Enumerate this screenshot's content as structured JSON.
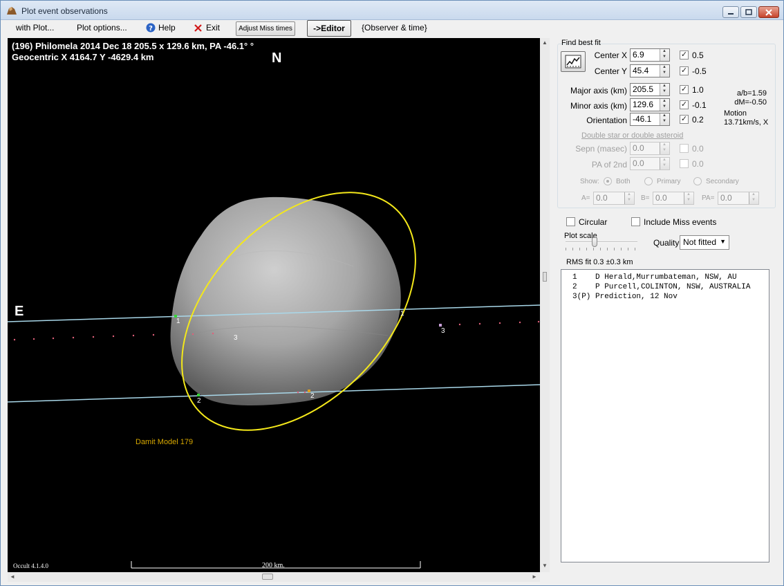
{
  "window": {
    "title": "Plot event observations"
  },
  "menu": {
    "with_plot": "with Plot...",
    "plot_options": "Plot options...",
    "help": "Help",
    "exit": "Exit",
    "adjust_miss": "Adjust Miss times",
    "editor": "->Editor",
    "observer_time": "{Observer & time}"
  },
  "plot": {
    "header_line1": "(196) Philomela  2014 Dec 18   205.5 x 129.6 km,  PA -46.1° °",
    "header_line2": "Geocentric  X 4164.7  Y -4629.4 km",
    "north": "N",
    "east": "E",
    "model_label": "Damit Model 179",
    "version": "Occult 4.1.4.0",
    "scale_label": "200 km.",
    "chord_labels": [
      "1",
      "3",
      "1",
      "2",
      "2",
      "3"
    ]
  },
  "fit": {
    "group_label": "Find best fit",
    "rows": [
      {
        "label": "Center X",
        "value": "6.9",
        "checked": true,
        "delta": "0.5"
      },
      {
        "label": "Center Y",
        "value": "45.4",
        "checked": true,
        "delta": "-0.5"
      },
      {
        "label": "Major axis (km)",
        "value": "205.5",
        "checked": true,
        "delta": "1.0"
      },
      {
        "label": "Minor axis (km)",
        "value": "129.6",
        "checked": true,
        "delta": "-0.1"
      },
      {
        "label": "Orientation",
        "value": "-46.1",
        "checked": true,
        "delta": "0.2"
      }
    ],
    "ab_ratio": "a/b=1.59",
    "dm": "dM=-0.50",
    "motion_label": "Motion",
    "motion_value": "13.71km/s, X",
    "double_star_link": "Double star  or  double asteroid",
    "sepn_label": "Sepn (masec)",
    "sepn_value": "0.0",
    "sepn_delta": "0.0",
    "pa2_label": "PA of 2nd",
    "pa2_value": "0.0",
    "pa2_delta": "0.0",
    "show_label": "Show:",
    "show_options": [
      "Both",
      "Primary",
      "Secondary"
    ],
    "a_label": "A=",
    "a_value": "0.0",
    "b_label": "B=",
    "b_value": "0.0",
    "pa_label": "PA=",
    "pa_value": "0.0",
    "circular_label": "Circular",
    "include_miss_label": "Include Miss events",
    "plot_scale_label": "Plot scale",
    "quality_label": "Quality",
    "quality_value": "Not fitted",
    "rms_label": "RMS fit  0.3 ±0.3 km"
  },
  "observers": [
    "1    D Herald,Murrumbateman, NSW, AU",
    "2    P Purcell,COLINTON, NSW, AUSTRALIA",
    "3(P) Prediction, 12 Nov"
  ]
}
